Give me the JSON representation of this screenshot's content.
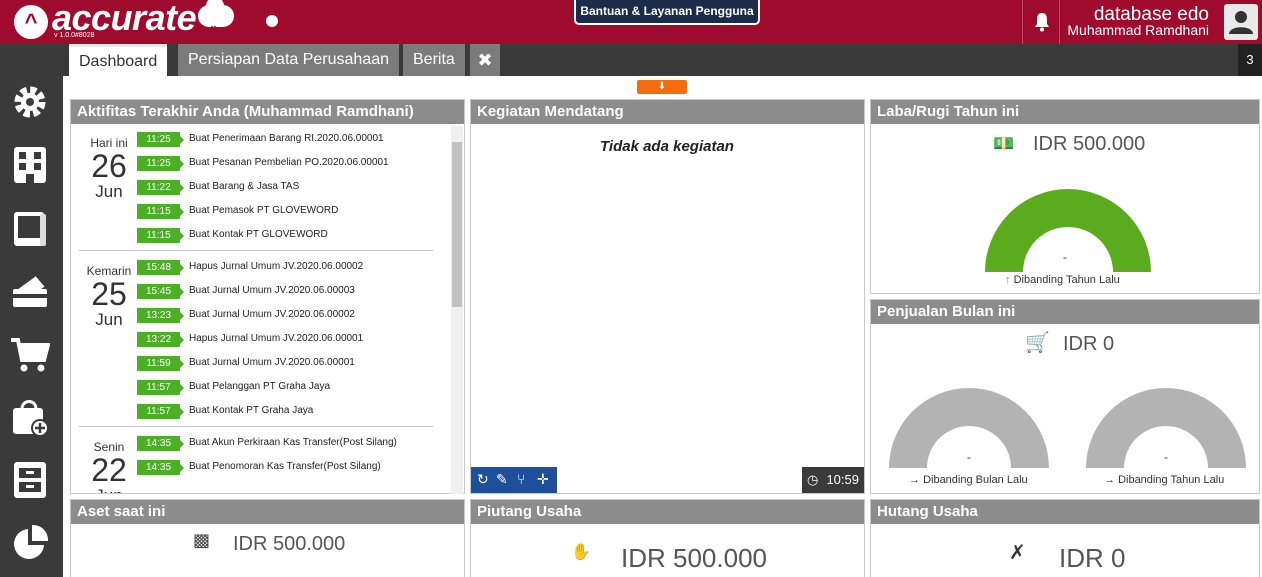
{
  "app": {
    "logo_text": "accurate",
    "logo_sub": "online",
    "version": "v 1.0.0#8028",
    "help_button": "Bantuan & Layanan Pengguna",
    "database": "database edo",
    "user": "Muhammad Ramdhani"
  },
  "sidebar": {
    "items": [
      {
        "icon": "settings-icon"
      },
      {
        "icon": "company-icon"
      },
      {
        "icon": "ledger-icon"
      },
      {
        "icon": "cash-bank-icon"
      },
      {
        "icon": "sales-cart-icon"
      },
      {
        "icon": "purchase-bag-icon"
      },
      {
        "icon": "inventory-icon"
      },
      {
        "icon": "report-pie-icon"
      }
    ]
  },
  "tabs": {
    "items": [
      {
        "label": "Dashboard"
      },
      {
        "label": "Persiapan Data Perusahaan"
      },
      {
        "label": "Berita"
      }
    ],
    "close_label": "✖",
    "count": "3"
  },
  "activity": {
    "title": "Aktifitas Terakhir Anda (Muhammad Ramdhani)",
    "groups": [
      {
        "label": "Hari ini",
        "day": "26",
        "month": "Jun",
        "rows": [
          {
            "time": "11:25",
            "desc": "Buat Penerimaan Barang RI.2020.06.00001"
          },
          {
            "time": "11:25",
            "desc": "Buat Pesanan Pembelian PO.2020.06.00001"
          },
          {
            "time": "11:22",
            "desc": "Buat Barang & Jasa TAS"
          },
          {
            "time": "11:15",
            "desc": "Buat Pemasok PT GLOVEWORD"
          },
          {
            "time": "11:15",
            "desc": "Buat Kontak PT GLOVEWORD"
          }
        ]
      },
      {
        "label": "Kemarin",
        "day": "25",
        "month": "Jun",
        "rows": [
          {
            "time": "15:48",
            "desc": "Hapus Jurnal Umum JV.2020.06.00002"
          },
          {
            "time": "15:45",
            "desc": "Buat Jurnal Umum JV.2020.06.00003"
          },
          {
            "time": "13:23",
            "desc": "Buat Jurnal Umum JV.2020.06.00002"
          },
          {
            "time": "13:22",
            "desc": "Hapus Jurnal Umum JV.2020.06.00001"
          },
          {
            "time": "11:59",
            "desc": "Buat Jurnal Umum JV.2020.06.00001"
          },
          {
            "time": "11:57",
            "desc": "Buat Pelanggan PT Graha Jaya"
          },
          {
            "time": "11:57",
            "desc": "Buat Kontak PT Graha Jaya"
          }
        ]
      },
      {
        "label": "Senin",
        "day": "22",
        "month": "Jun",
        "rows": [
          {
            "time": "14:35",
            "desc": "Buat Akun Perkiraan Kas Transfer(Post Silang)"
          },
          {
            "time": "14:35",
            "desc": "Buat Penomoran Kas Transfer(Post Silang)"
          }
        ]
      }
    ]
  },
  "events": {
    "title": "Kegiatan Mendatang",
    "empty_text": "Tidak ada kegiatan",
    "clock": "10:59"
  },
  "profit": {
    "title": "Laba/Rugi Tahun ini",
    "amount": "IDR 500.000",
    "gauge_value": "-",
    "gauge_color": "#5aab1e",
    "gauge_fill": 1.0,
    "compare": "Dibanding Tahun Lalu"
  },
  "sales": {
    "title": "Penjualan Bulan ini",
    "amount": "IDR 0",
    "gauges": [
      {
        "value": "-",
        "compare": "Dibanding Bulan Lalu",
        "color": "#b3b3b3"
      },
      {
        "value": "-",
        "compare": "Dibanding Tahun Lalu",
        "color": "#b3b3b3"
      }
    ]
  },
  "assets": {
    "title": "Aset saat ini",
    "amount": "IDR 500.000"
  },
  "receivables": {
    "title": "Piutang Usaha",
    "amount": "IDR 500.000"
  },
  "payables": {
    "title": "Hutang Usaha",
    "amount": "IDR 0"
  },
  "colors": {
    "brand": "#9e0b2d",
    "success": "#4caf26",
    "accent": "#f36c0d",
    "toolbar": "#1d4f9a"
  }
}
